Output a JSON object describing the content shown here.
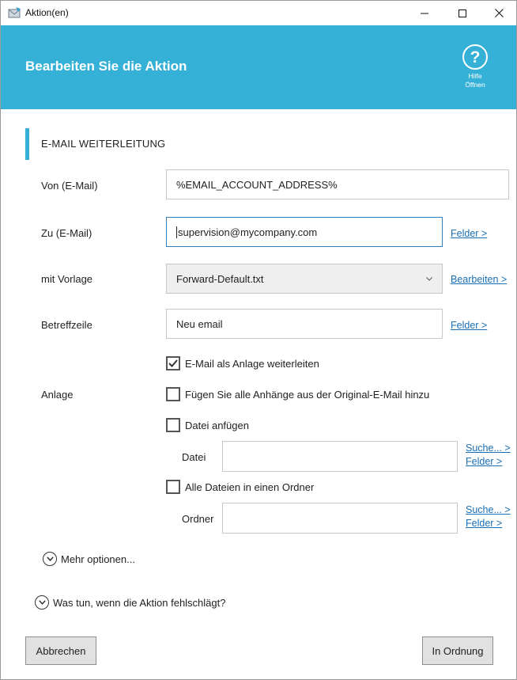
{
  "window": {
    "title": "Aktion(en)"
  },
  "header": {
    "title": "Bearbeiten Sie die Aktion",
    "help_line1": "Hilfe",
    "help_line2": "Öffnen",
    "accent_color": "#35b0d6"
  },
  "section": {
    "title": "E-MAIL WEITERLEITUNG"
  },
  "form": {
    "from": {
      "label": "Von (E-Mail)",
      "value": "%EMAIL_ACCOUNT_ADDRESS%"
    },
    "to": {
      "label": "Zu (E-Mail)",
      "value": "supervision@mycompany.com",
      "link": "Felder >"
    },
    "template": {
      "label": "mit Vorlage",
      "value": "Forward-Default.txt",
      "link": "Bearbeiten >"
    },
    "subject": {
      "label": "Betreffzeile",
      "value": "Neu email",
      "link": "Felder >"
    },
    "attachment": {
      "label": "Anlage",
      "forward_as_attachment": {
        "label": "E-Mail als Anlage weiterleiten",
        "checked": true
      },
      "add_all_attachments": {
        "label": "Fügen Sie alle Anhänge aus der Original-E-Mail hinzu",
        "checked": false
      },
      "attach_file": {
        "label": "Datei anfügen",
        "checked": false
      },
      "file": {
        "label": "Datei",
        "value": "",
        "search_link": "Suche... >",
        "fields_link": "Felder >"
      },
      "all_files_folder": {
        "label": "Alle Dateien in einen Ordner",
        "checked": false
      },
      "folder": {
        "label": "Ordner",
        "value": "",
        "search_link": "Suche... >",
        "fields_link": "Felder >"
      }
    }
  },
  "more_options": {
    "label": "Mehr optionen..."
  },
  "on_failure": {
    "label": "Was tun, wenn die Aktion fehlschlägt?"
  },
  "buttons": {
    "cancel": "Abbrechen",
    "ok": "In Ordnung"
  }
}
